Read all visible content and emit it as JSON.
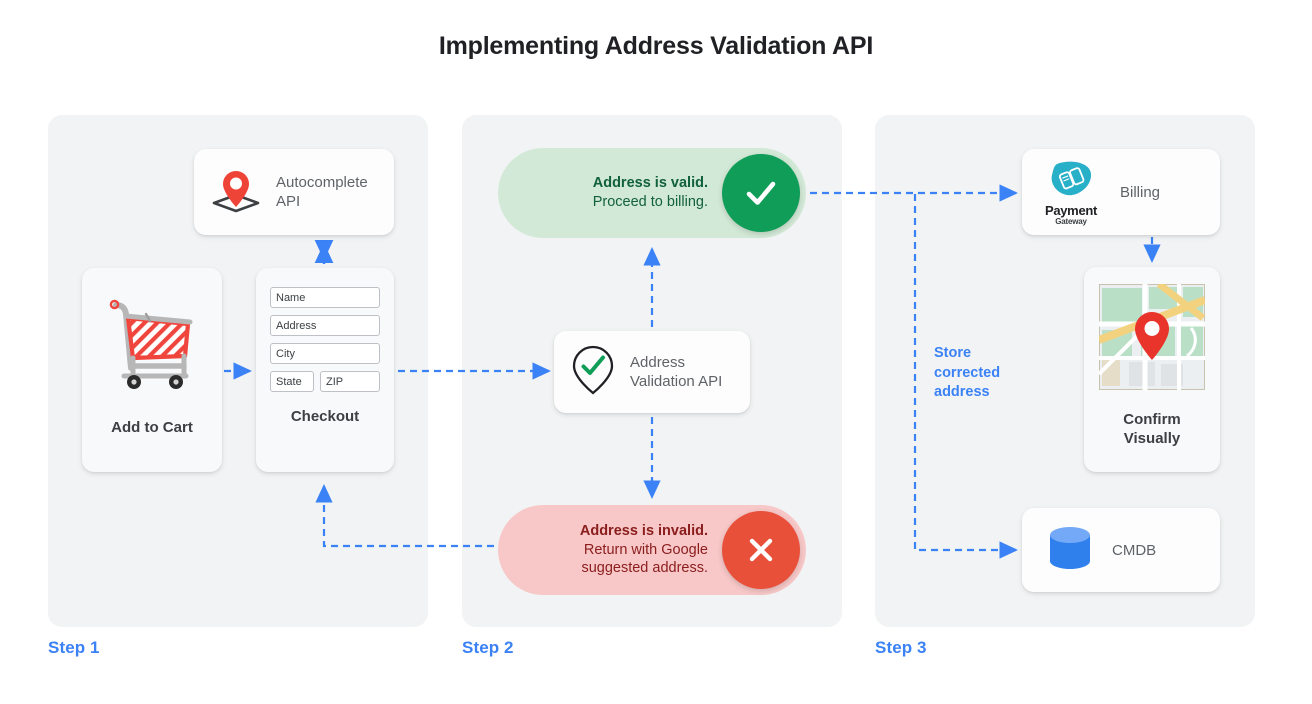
{
  "page": {
    "title": "Implementing Address Validation API",
    "accent_blue": "#3b82f6",
    "panel_bg": "#f1f3f4",
    "green": "#0f9d58",
    "red": "#e8503a"
  },
  "steps": [
    {
      "label": "Step 1"
    },
    {
      "label": "Step 2"
    },
    {
      "label": "Step 3"
    }
  ],
  "step1": {
    "autocomplete_card": {
      "label_line1": "Autocomplete",
      "label_line2": "API",
      "icon": "map-pin-diamond-icon"
    },
    "cart_card": {
      "caption": "Add to Cart",
      "icon": "shopping-cart-icon"
    },
    "checkout_card": {
      "caption": "Checkout",
      "fields": [
        {
          "name": "name-field",
          "label": "Name"
        },
        {
          "name": "address-field",
          "label": "Address"
        },
        {
          "name": "city-field",
          "label": "City"
        },
        {
          "name": "state-field",
          "label": "State"
        },
        {
          "name": "zip-field",
          "label": "ZIP"
        }
      ]
    }
  },
  "step2": {
    "valid_pill": {
      "line1": "Address is valid.",
      "line2": "Proceed to billing.",
      "badge_icon": "check-icon",
      "badge_color": "#0f9d58",
      "bg_color": "#d3e9d7"
    },
    "invalid_pill": {
      "line1": "Address is invalid.",
      "line2": "Return with Google",
      "line3": "suggested address.",
      "badge_icon": "close-x-icon",
      "badge_color": "#e8503a",
      "bg_color": "#f8c8c8"
    },
    "validation_card": {
      "label_line1": "Address",
      "label_line2": "Validation API",
      "icon": "pin-check-icon"
    }
  },
  "step3": {
    "billing_card": {
      "label": "Billing",
      "logo_word1": "Payment",
      "logo_word2": "Gateway",
      "logo_icon": "payment-gateway-icon"
    },
    "map_card": {
      "caption_line1": "Confirm",
      "caption_line2": "Visually",
      "icon": "map-thumbnail-icon"
    },
    "cmdb_card": {
      "label": "CMDB",
      "icon": "database-cylinder-icon"
    },
    "store_label": {
      "line1": "Store",
      "line2": "corrected",
      "line3": "address"
    }
  }
}
